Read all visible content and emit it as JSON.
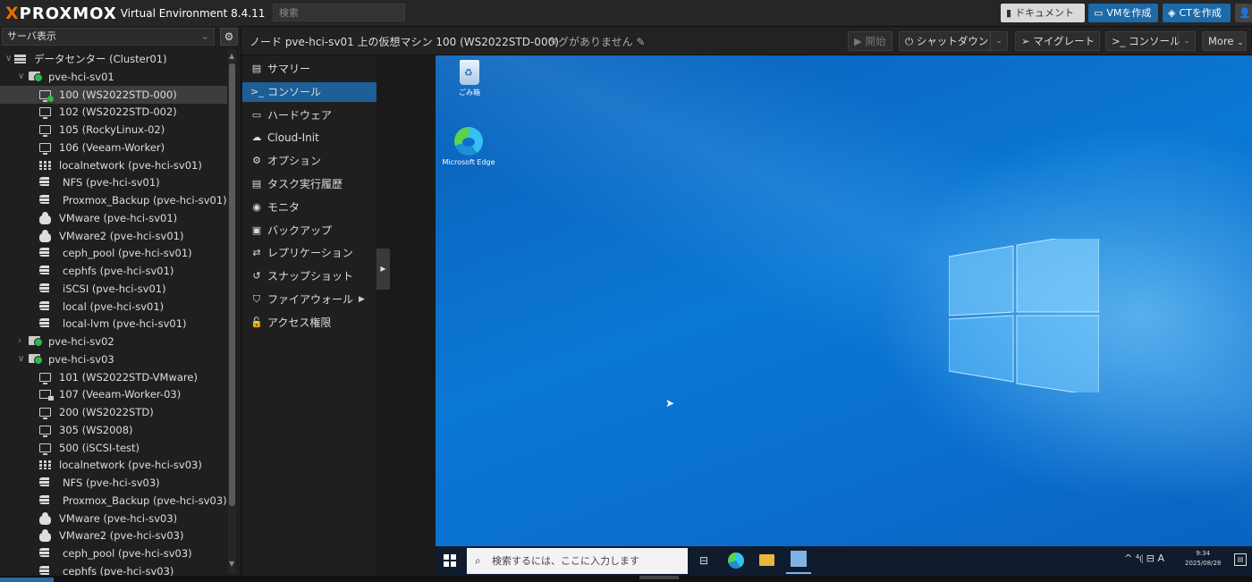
{
  "topbar": {
    "logo_x": "X",
    "logo_brand": "PROXMOX",
    "product": "Virtual Environment 8.4.11",
    "search_placeholder": "検索",
    "docs_label": "ドキュメント",
    "create_vm_label": "VMを作成",
    "create_ct_label": "CTを作成",
    "accent": "#e57000",
    "primary_button_color": "#1d6aa8"
  },
  "leftpanel": {
    "view_label": "サーバ表示",
    "tree": [
      {
        "label": "データセンター (Cluster01)",
        "icon": "datacenter-icon",
        "level": 0,
        "twisty": "∨"
      },
      {
        "label": "pve-hci-sv01",
        "icon": "node-icon",
        "level": 1,
        "twisty": "∨"
      },
      {
        "label": "100 (WS2022STD-000)",
        "icon": "vm-running-icon",
        "level": 2,
        "selected": true
      },
      {
        "label": "102 (WS2022STD-002)",
        "icon": "vm-icon",
        "level": 2
      },
      {
        "label": "105 (RockyLinux-02)",
        "icon": "vm-icon",
        "level": 2
      },
      {
        "label": "106 (Veeam-Worker)",
        "icon": "vm-icon",
        "level": 2
      },
      {
        "label": "localnetwork (pve-hci-sv01)",
        "icon": "network-icon",
        "level": 2
      },
      {
        "label": "NFS (pve-hci-sv01)",
        "icon": "storage-icon",
        "level": 2
      },
      {
        "label": "Proxmox_Backup (pve-hci-sv01)",
        "icon": "storage-icon",
        "level": 2
      },
      {
        "label": "VMware (pve-hci-sv01)",
        "icon": "cloud-storage-icon",
        "level": 2
      },
      {
        "label": "VMware2 (pve-hci-sv01)",
        "icon": "cloud-storage-icon",
        "level": 2
      },
      {
        "label": "ceph_pool (pve-hci-sv01)",
        "icon": "storage-icon",
        "level": 2
      },
      {
        "label": "cephfs (pve-hci-sv01)",
        "icon": "storage-icon",
        "level": 2
      },
      {
        "label": "iSCSI (pve-hci-sv01)",
        "icon": "storage-icon",
        "level": 2
      },
      {
        "label": "local (pve-hci-sv01)",
        "icon": "storage-icon",
        "level": 2
      },
      {
        "label": "local-lvm (pve-hci-sv01)",
        "icon": "storage-icon",
        "level": 2
      },
      {
        "label": "pve-hci-sv02",
        "icon": "node-icon",
        "level": 1,
        "twisty": "›"
      },
      {
        "label": "pve-hci-sv03",
        "icon": "node-icon",
        "level": 1,
        "twisty": "∨"
      },
      {
        "label": "101 (WS2022STD-VMware)",
        "icon": "vm-icon",
        "level": 2
      },
      {
        "label": "107 (Veeam-Worker-03)",
        "icon": "vm-locked-icon",
        "level": 2
      },
      {
        "label": "200 (WS2022STD)",
        "icon": "vm-icon",
        "level": 2
      },
      {
        "label": "305 (WS2008)",
        "icon": "vm-icon",
        "level": 2
      },
      {
        "label": "500 (iSCSI-test)",
        "icon": "vm-icon",
        "level": 2
      },
      {
        "label": "localnetwork (pve-hci-sv03)",
        "icon": "network-icon",
        "level": 2
      },
      {
        "label": "NFS (pve-hci-sv03)",
        "icon": "storage-icon",
        "level": 2
      },
      {
        "label": "Proxmox_Backup (pve-hci-sv03)",
        "icon": "storage-icon",
        "level": 2
      },
      {
        "label": "VMware (pve-hci-sv03)",
        "icon": "cloud-storage-icon",
        "level": 2
      },
      {
        "label": "VMware2 (pve-hci-sv03)",
        "icon": "cloud-storage-icon",
        "level": 2
      },
      {
        "label": "ceph_pool (pve-hci-sv03)",
        "icon": "storage-icon",
        "level": 2
      },
      {
        "label": "cephfs (pve-hci-sv03)",
        "icon": "storage-icon",
        "level": 2
      }
    ]
  },
  "header": {
    "breadcrumb": "ノード pve-hci-sv01 上の仮想マシン 100 (WS2022STD-000)",
    "tags_label": "タグがありません",
    "start_label": "開始",
    "shutdown_label": "シャットダウン",
    "migrate_label": "マイグレート",
    "console_label": "コンソール",
    "more_label": "More"
  },
  "nav": {
    "items": [
      {
        "label": "サマリー",
        "icon": "summary-icon",
        "glyph": "▤"
      },
      {
        "label": "コンソール",
        "icon": "terminal-icon",
        "glyph": ">_",
        "selected": true
      },
      {
        "label": "ハードウェア",
        "icon": "hardware-icon",
        "glyph": "▭"
      },
      {
        "label": "Cloud-Init",
        "icon": "cloud-icon",
        "glyph": "☁"
      },
      {
        "label": "オプション",
        "icon": "gear-icon",
        "glyph": "⚙"
      },
      {
        "label": "タスク実行履歴",
        "icon": "task-history-icon",
        "glyph": "▤"
      },
      {
        "label": "モニタ",
        "icon": "eye-icon",
        "glyph": "◉"
      },
      {
        "label": "バックアップ",
        "icon": "floppy-icon",
        "glyph": "▣"
      },
      {
        "label": "レプリケーション",
        "icon": "replication-icon",
        "glyph": "⇄"
      },
      {
        "label": "スナップショット",
        "icon": "history-icon",
        "glyph": "↺"
      },
      {
        "label": "ファイアウォール",
        "icon": "shield-icon",
        "glyph": "⛉",
        "submenu": true
      },
      {
        "label": "アクセス権限",
        "icon": "unlock-icon",
        "glyph": "🔓"
      }
    ]
  },
  "desktop": {
    "recycle_bin_label": "ごみ箱",
    "edge_label": "Microsoft Edge",
    "taskbar_search": "検索するには、ここに入力します",
    "systray": "^  ⁴⦇  ⊟  A",
    "clock_time": "9:34",
    "clock_date": "2025/08/28",
    "wallpaper_color": "#0b78d4"
  }
}
